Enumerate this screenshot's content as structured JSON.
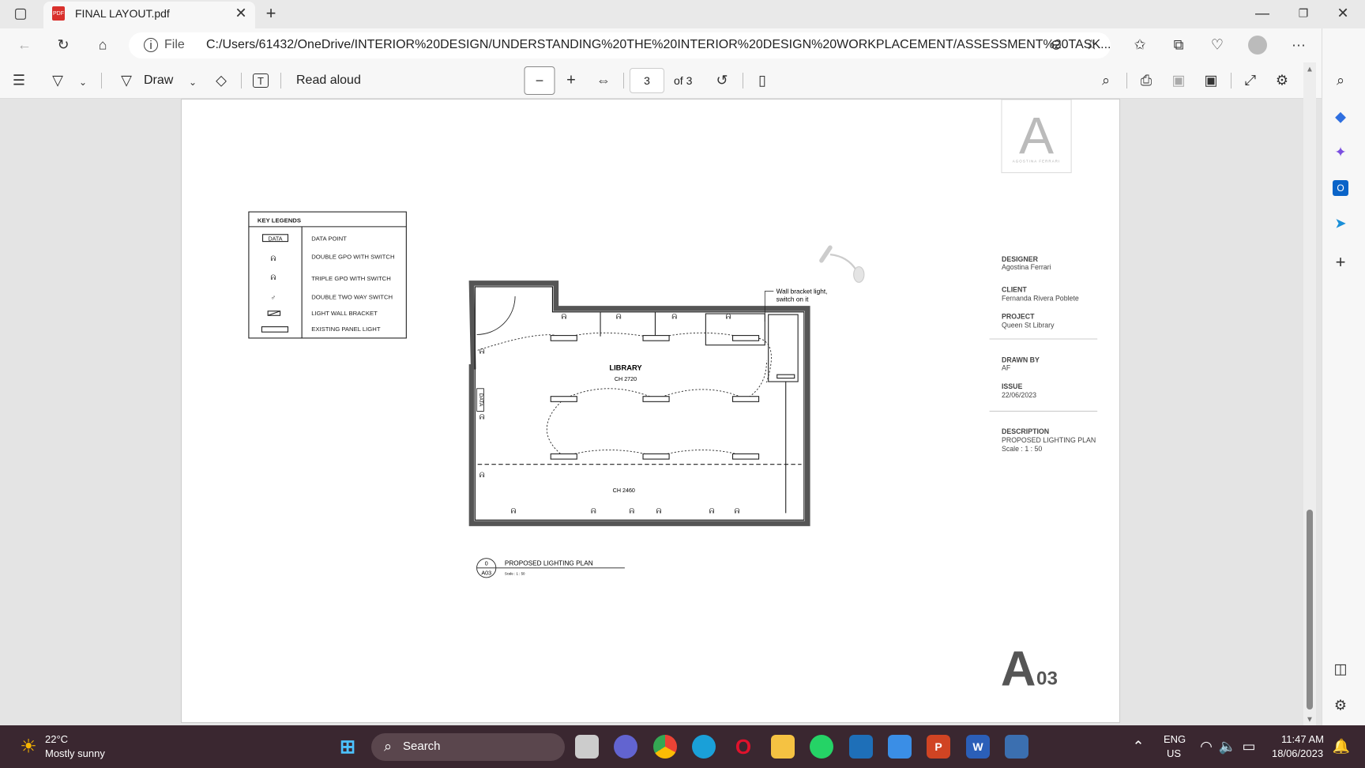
{
  "tab": {
    "title": "FINAL LAYOUT.pdf"
  },
  "address": {
    "scheme": "File",
    "url": "C:/Users/61432/OneDrive/INTERIOR%20DESIGN/UNDERSTANDING%20THE%20INTERIOR%20DESIGN%20WORKPLACEMENT/ASSESSMENT%20TASK..."
  },
  "toolbar": {
    "draw": "Draw",
    "read_aloud": "Read aloud",
    "page": "3",
    "page_of": "of 3"
  },
  "legend": {
    "title": "KEY LEGENDS",
    "data_symbol": "DATA",
    "items": [
      "DATA POINT",
      "DOUBLE GPO WITH SWITCH",
      "TRIPLE GPO WITH SWITCH",
      "DOUBLE TWO WAY SWITCH",
      "LIGHT WALL BRACKET",
      "EXISTING PANEL LIGHT"
    ]
  },
  "plan": {
    "room": "LIBRARY",
    "ch1": "CH 2720",
    "ch2": "CH 2460",
    "note1": "Wall bracket light,",
    "note2": "switch on it",
    "data_tag": "DATA",
    "title": "PROPOSED LIGHTING PLAN",
    "scale": "Scale : 1 : 50",
    "ref_num": "0",
    "ref_sheet": "A03"
  },
  "logo": {
    "letter": "A",
    "name": "AGOSTINA FERRARI"
  },
  "titleblock": {
    "designer_label": "DESIGNER",
    "designer": "Agostina Ferrari",
    "client_label": "CLIENT",
    "client": "Fernanda Rivera Poblete",
    "project_label": "PROJECT",
    "project": "Queen St Library",
    "drawn_label": "DRAWN BY",
    "drawn": "AF",
    "issue_label": "ISSUE",
    "issue": "22/06/2023",
    "desc_label": "DESCRIPTION",
    "desc": "PROPOSED LIGHTING PLAN",
    "desc_scale": "Scale : 1 : 50",
    "sheet_letter": "A",
    "sheet_num": "03"
  },
  "taskbar": {
    "temp": "22°C",
    "weather": "Mostly sunny",
    "search": "Search",
    "lang1": "ENG",
    "lang2": "US",
    "time": "11:47 AM",
    "date": "18/06/2023"
  }
}
